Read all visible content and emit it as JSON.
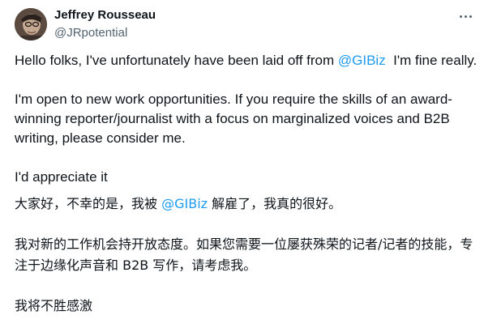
{
  "tweet": {
    "author": {
      "name": "Jeffrey Rousseau",
      "handle": "@JRpotential"
    },
    "more_icon": "more-horizontal-icon",
    "mention_color": "#1d9bf0",
    "en": {
      "p1_before": "Hello folks, I've unfortunately have been laid off from ",
      "p1_mention": "@GIBiz",
      "p1_after": "  I'm fine really.",
      "p2": "I'm open to new work opportunities. If you require the skills of an award-winning reporter/journalist with a focus on marginalized voices and B2B writing, please consider me.",
      "p3": "I'd appreciate it"
    },
    "zh": {
      "p1_before": "大家好，不幸的是，我被 ",
      "p1_mention": "@GIBiz",
      "p1_after": " 解雇了，我真的很好。",
      "p2": "我对新的工作机会持开放态度。如果您需要一位屡获殊荣的记者/记者的技能，专注于边缘化声音和 B2B 写作，请考虑我。",
      "p3": "我将不胜感激"
    }
  }
}
